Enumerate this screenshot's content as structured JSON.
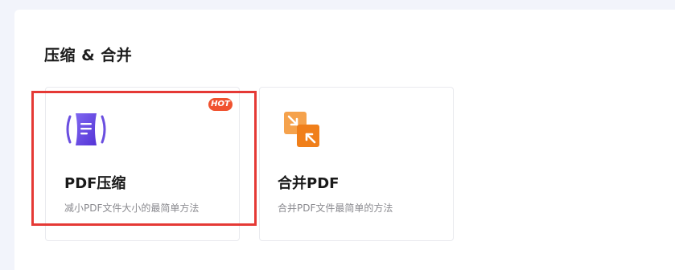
{
  "section": {
    "title": "压缩 & 合并"
  },
  "cards": [
    {
      "title": "PDF压缩",
      "description": "减小PDF文件大小的最简单方法",
      "badge": "HOT",
      "icon": "compress-icon",
      "accent_color": "#6a4ee0"
    },
    {
      "title": "合并PDF",
      "description": "合并PDF文件最简单的方法",
      "icon": "merge-icon",
      "accent_color": "#f08a24"
    }
  ],
  "colors": {
    "background": "#f2f4fb",
    "highlight": "#e53935",
    "badge": "#f0522f"
  }
}
